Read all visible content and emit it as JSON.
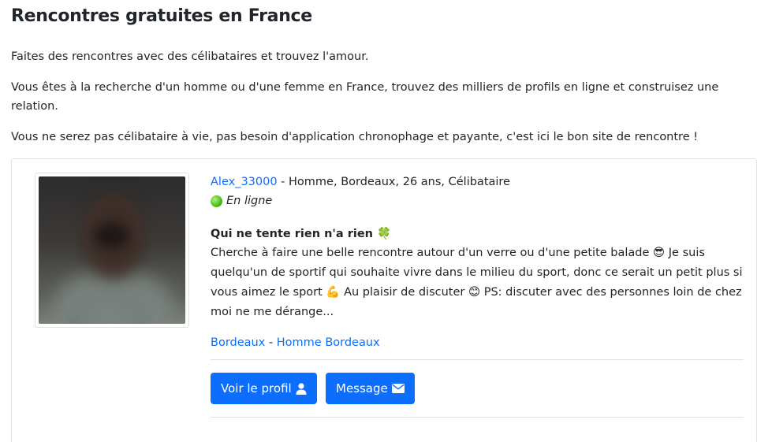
{
  "page": {
    "title": "Rencontres gratuites en France",
    "intro_1": "Faites des rencontres avec des célibataires et trouvez l'amour.",
    "intro_2": "Vous êtes à la recherche d'un homme ou d'une femme en France, trouvez des milliers de profils en ligne et construisez une relation.",
    "intro_3": "Vous ne serez pas célibataire à vie, pas besoin d'application chronophage et payante, c'est ici le bon site de rencontre !"
  },
  "profile": {
    "username": "Alex_33000",
    "details": " - Homme, Bordeaux, 26 ans, Célibataire",
    "status": "En ligne",
    "headline": "Qui ne tente rien n'a rien 🍀",
    "description": "Cherche à faire une belle rencontre autour d'un verre ou d'une petite balade 😎 Je suis quelqu'un de sportif qui souhaite vivre dans le milieu du sport, donc ce serait un petit plus si vous aimez le sport 💪 Au plaisir de discuter 😊 PS: discuter avec des personnes loin de chez moi ne me dérange...",
    "tag_city": "Bordeaux",
    "tag_separator": " - ",
    "tag_search": "Homme Bordeaux"
  },
  "actions": {
    "view_profile": "Voir le profil",
    "message": "Message"
  },
  "colors": {
    "accent": "#0d6efd",
    "online": "#4cc21d",
    "border": "#dee2e6"
  },
  "icons": {
    "view_profile": "user-icon",
    "message": "envelope-icon",
    "status": "online-dot-icon"
  }
}
